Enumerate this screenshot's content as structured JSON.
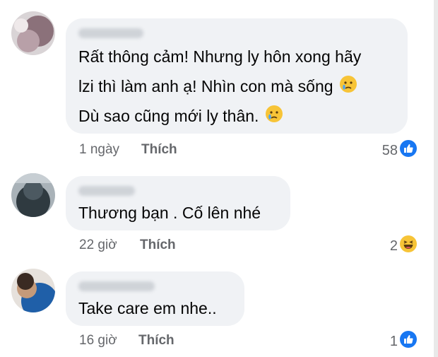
{
  "comments": [
    {
      "lines": [
        "Rất thông cảm! Nhưng ly hôn xong hãy",
        "lzi thì làm anh ạ! Nhìn con mà sống",
        "Dù sao cũng mới ly thân."
      ],
      "time": "1 ngày",
      "like_label": "Thích",
      "reaction_count": "58",
      "reaction_icon": "like-icon"
    },
    {
      "lines": [
        "Thương bạn . Cố lên nhé"
      ],
      "time": "22 giờ",
      "like_label": "Thích",
      "reaction_count": "2",
      "reaction_icon": "haha-icon"
    },
    {
      "lines": [
        "Take care em nhe.."
      ],
      "time": "16 giờ",
      "like_label": "Thích",
      "reaction_count": "1",
      "reaction_icon": "like-icon"
    }
  ],
  "colors": {
    "bubble": "#f0f2f5",
    "meta_text": "#65676b",
    "like_blue": "#1877f2",
    "haha_yellow": "#f7c437"
  }
}
